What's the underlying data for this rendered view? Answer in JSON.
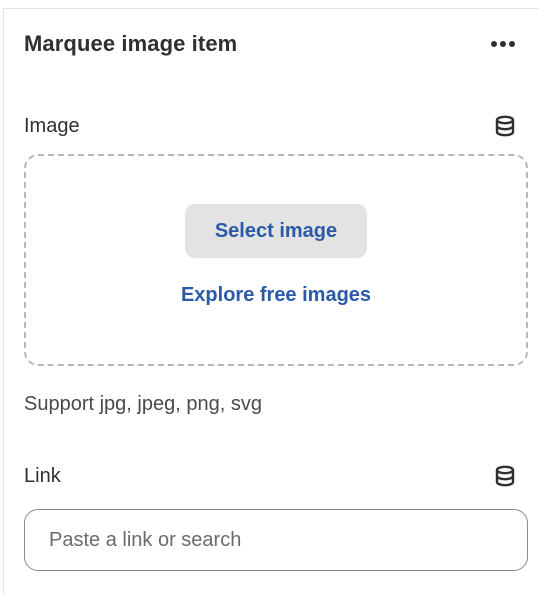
{
  "panel": {
    "title": "Marquee image item",
    "more_icon": "more-horizontal-icon"
  },
  "image_field": {
    "label": "Image",
    "source_icon": "database-icon",
    "select_button_label": "Select image",
    "explore_link_label": "Explore free images",
    "support_text": "Support jpg, jpeg, png, svg"
  },
  "link_field": {
    "label": "Link",
    "source_icon": "database-icon",
    "placeholder": "Paste a link or search",
    "value": ""
  },
  "colors": {
    "link_blue": "#2a5aa8",
    "button_gray": "#e3e3e3",
    "text": "#303030"
  }
}
